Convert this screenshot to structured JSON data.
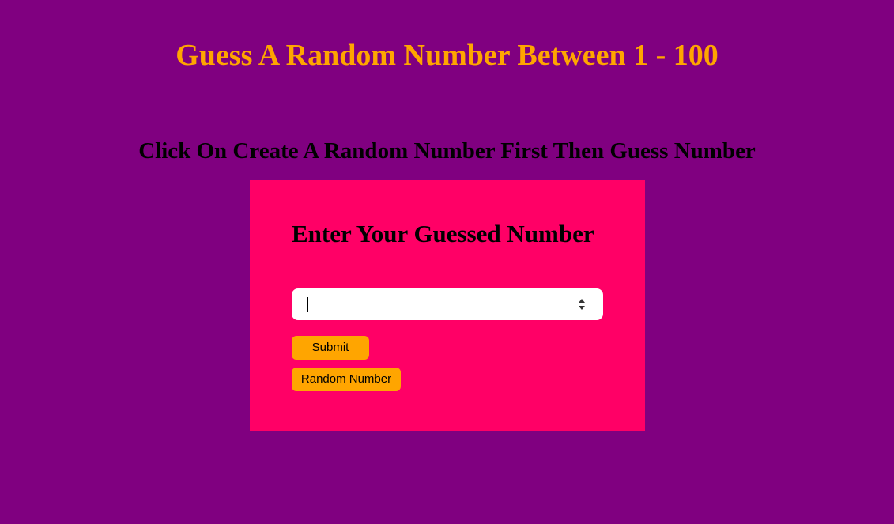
{
  "page": {
    "title": "Guess A Random Number Between 1 - 100",
    "subtitle": "Click On Create A Random Number First Then Guess Number"
  },
  "card": {
    "heading": "Enter Your Guessed Number",
    "input": {
      "value": "",
      "placeholder": ""
    },
    "submit_label": "Submit",
    "random_label": "Random Number"
  },
  "colors": {
    "background": "#800080",
    "title": "#FFA500",
    "card": "#FF0066",
    "button": "#FFA500"
  }
}
